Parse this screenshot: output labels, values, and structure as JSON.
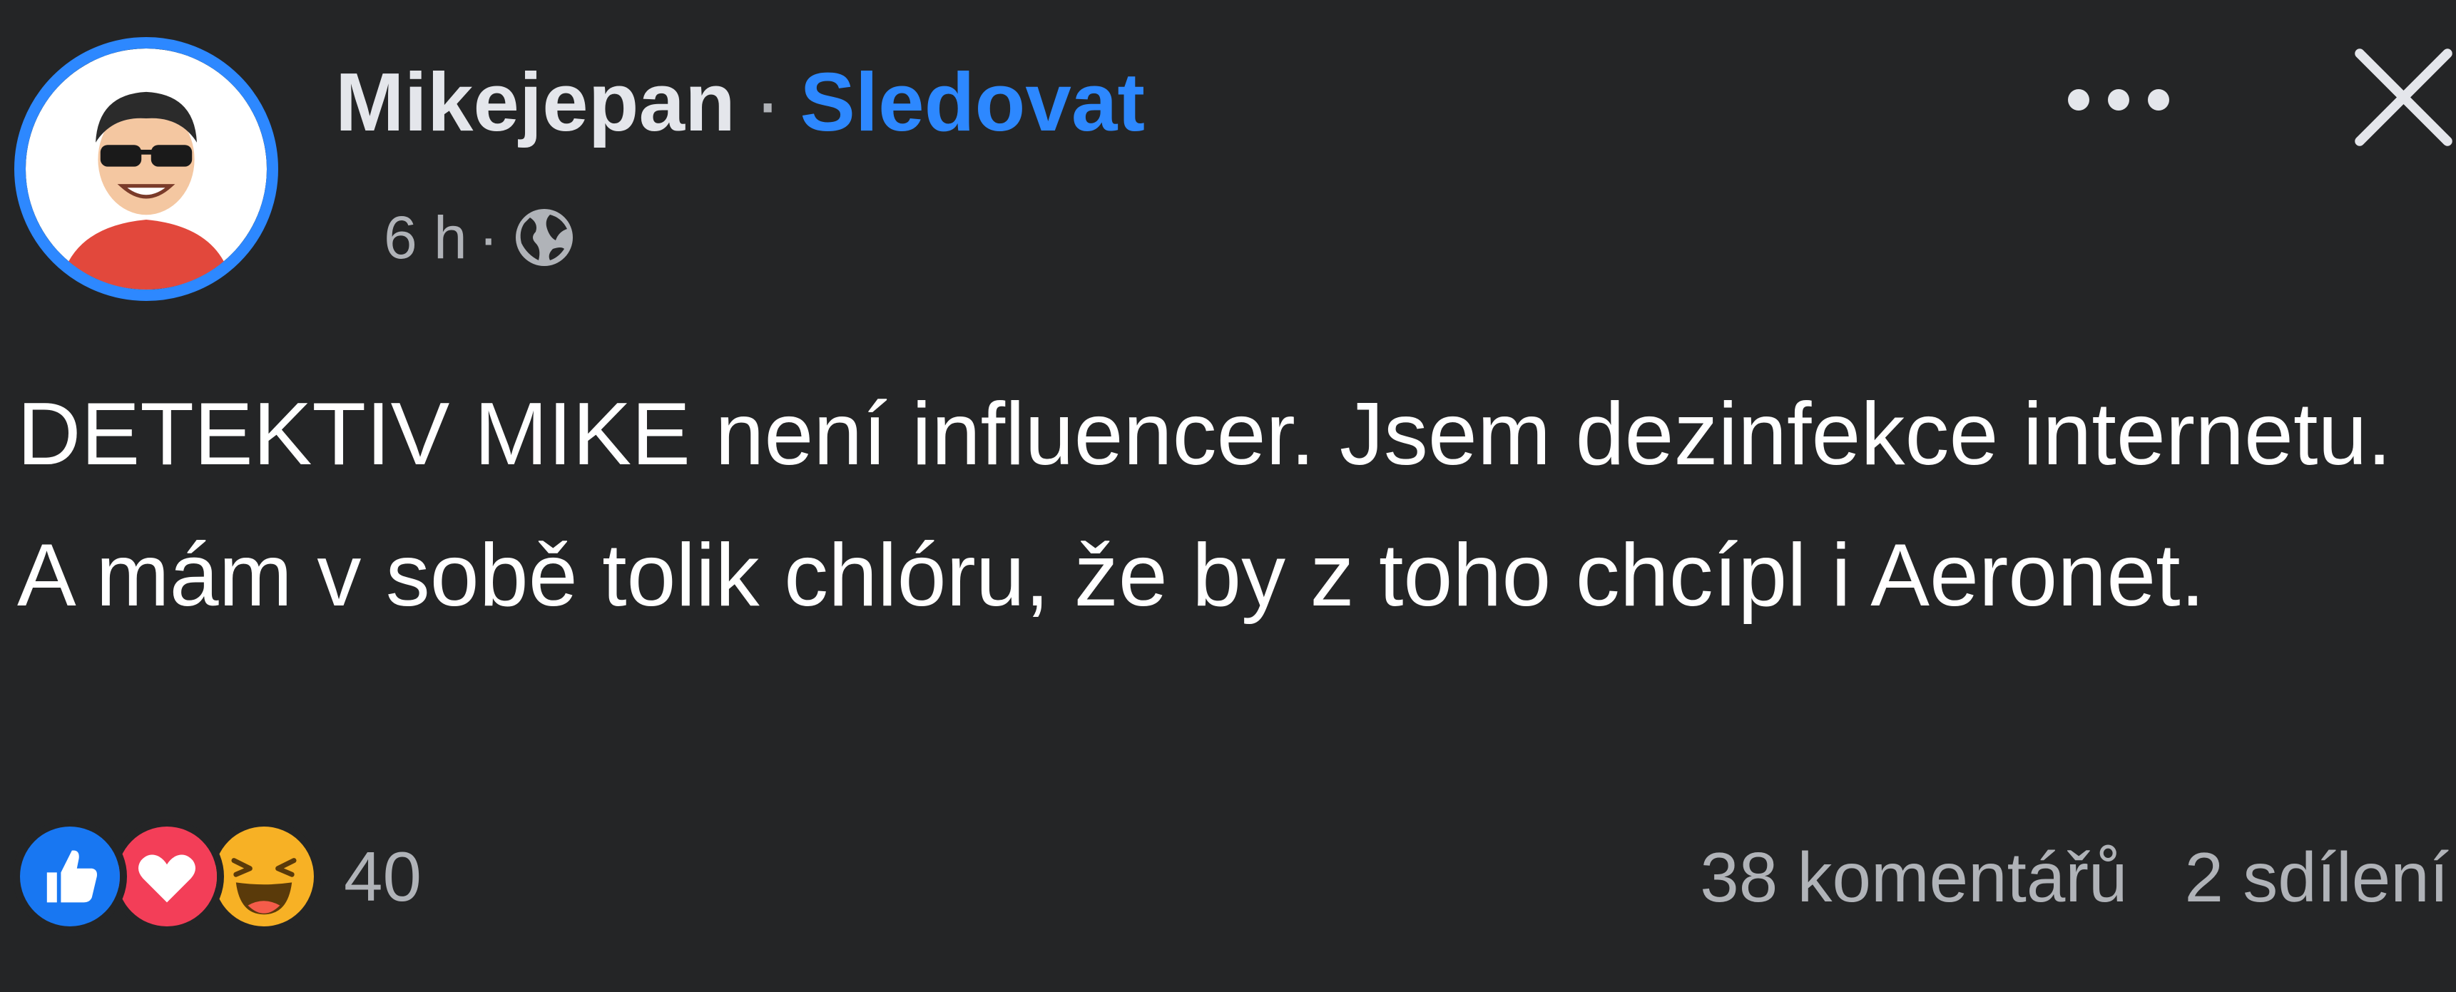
{
  "post": {
    "author": "Mikejepan",
    "separator": "·",
    "follow_label": "Sledovat",
    "time": "6 h",
    "meta_separator": "·",
    "privacy_icon": "globe-icon",
    "text": "DETEKTIV MIKE není influencer. Jsem dezinfekce internetu. A mám v sobě tolik chlóru, že by z toho chcípl i Aeronet."
  },
  "header_actions": {
    "more_icon": "more-horizontal-icon",
    "close_icon": "close-icon"
  },
  "reactions": {
    "icons": [
      "like-icon",
      "love-icon",
      "haha-icon"
    ],
    "count": "40"
  },
  "stats": {
    "comments": "38 komentářů",
    "shares": "2 sdílení"
  },
  "colors": {
    "background": "#242526",
    "text_primary": "#e4e6eb",
    "text_secondary": "#b0b3b8",
    "accent": "#2d88ff",
    "love": "#f33e58",
    "haha": "#f7b125"
  }
}
